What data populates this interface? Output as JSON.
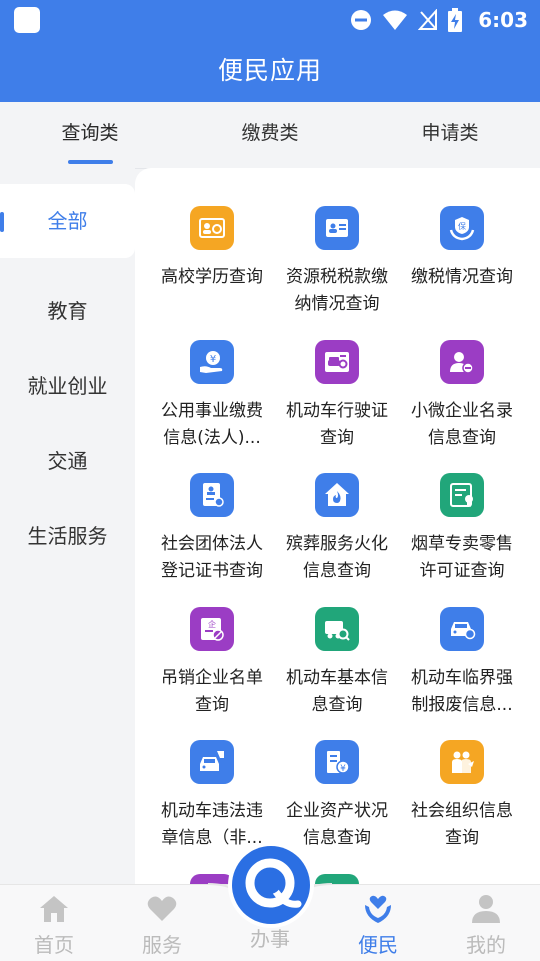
{
  "status": {
    "time": "6:03"
  },
  "title": "便民应用",
  "tabs": [
    {
      "label": "查询类",
      "active": true
    },
    {
      "label": "缴费类",
      "active": false
    },
    {
      "label": "申请类",
      "active": false
    }
  ],
  "sidebar": [
    {
      "label": "全部",
      "active": true
    },
    {
      "label": "教育",
      "active": false
    },
    {
      "label": "就业创业",
      "active": false
    },
    {
      "label": "交通",
      "active": false
    },
    {
      "label": "生活服务",
      "active": false
    }
  ],
  "items": [
    {
      "line1": "高校学历查询",
      "line2": "",
      "icon": "education-certificate-icon",
      "color": "#f5a623"
    },
    {
      "line1": "资源税税款缴",
      "line2": "纳情况查询",
      "icon": "id-card-icon",
      "color": "#3f7ee9"
    },
    {
      "line1": "缴税情况查询",
      "line2": "",
      "icon": "insurance-hands-icon",
      "color": "#3f7ee9"
    },
    {
      "line1": "公用事业缴费",
      "line2": "信息(法人)...",
      "icon": "yuan-hand-icon",
      "color": "#3f7ee9"
    },
    {
      "line1": "机动车行驶证",
      "line2": "查询",
      "icon": "vehicle-license-icon",
      "color": "#9b3dc4"
    },
    {
      "line1": "小微企业名录",
      "line2": "信息查询",
      "icon": "users-minus-icon",
      "color": "#9b3dc4"
    },
    {
      "line1": "社会团体法人",
      "line2": "登记证书查询",
      "icon": "document-edit-icon",
      "color": "#3f7ee9"
    },
    {
      "line1": "殡葬服务火化",
      "line2": "信息查询",
      "icon": "house-flame-icon",
      "color": "#3f7ee9"
    },
    {
      "line1": "烟草专卖零售",
      "line2": "许可证查询",
      "icon": "certificate-icon",
      "color": "#21a67a"
    },
    {
      "line1": "吊销企业名单",
      "line2": "查询",
      "icon": "enterprise-revoke-icon",
      "color": "#9b3dc4"
    },
    {
      "line1": "机动车基本信",
      "line2": "息查询",
      "icon": "truck-search-icon",
      "color": "#21a67a"
    },
    {
      "line1": "机动车临界强",
      "line2": "制报废信息...",
      "icon": "car-badge-icon",
      "color": "#3f7ee9"
    },
    {
      "line1": "机动车违法违",
      "line2": "章信息（非...",
      "icon": "car-violation-icon",
      "color": "#3f7ee9"
    },
    {
      "line1": "企业资产状况",
      "line2": "信息查询",
      "icon": "building-yuan-icon",
      "color": "#3f7ee9"
    },
    {
      "line1": "社会组织信息",
      "line2": "查询",
      "icon": "organization-people-icon",
      "color": "#f5a623"
    }
  ],
  "partial_icons": [
    {
      "icon": "partial-purple-icon",
      "color": "#9b3dc4"
    },
    {
      "icon": "partial-green-icon",
      "color": "#21a67a"
    }
  ],
  "bottom_nav": [
    {
      "label": "首页",
      "icon": "home-icon",
      "active": false
    },
    {
      "label": "服务",
      "icon": "heart-icon",
      "active": false
    },
    {
      "label": "办事",
      "icon": "q-logo-icon",
      "active": false
    },
    {
      "label": "便民",
      "icon": "hands-heart-icon",
      "active": true
    },
    {
      "label": "我的",
      "icon": "user-icon",
      "active": false
    }
  ]
}
